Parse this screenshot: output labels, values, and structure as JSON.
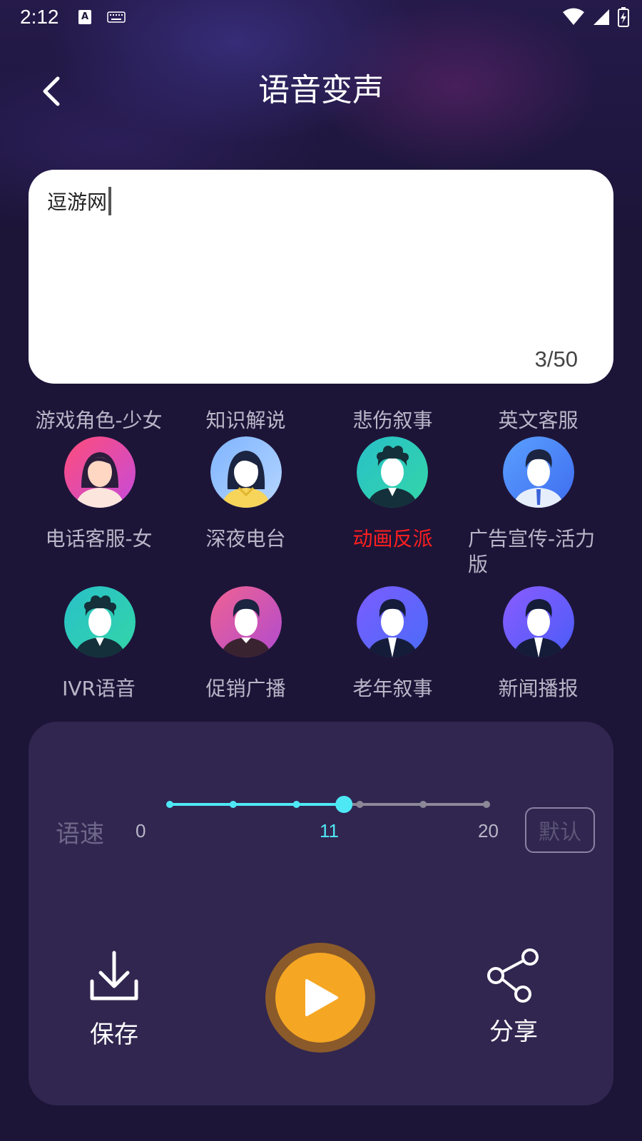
{
  "status": {
    "time": "2:12",
    "input_icon": "A"
  },
  "header": {
    "title": "语音变声"
  },
  "editor": {
    "text": "逗游网",
    "counter": "3/50"
  },
  "voices": [
    {
      "label": "游戏角色-少女",
      "icon": "female-avatar-icon"
    },
    {
      "label": "知识解说",
      "icon": "female-avatar-icon"
    },
    {
      "label": "悲伤叙事",
      "icon": "male-curly-avatar-icon"
    },
    {
      "label": "英文客服",
      "icon": "male-avatar-icon"
    },
    {
      "label": "电话客服-女",
      "icon": "male-curly-avatar-icon"
    },
    {
      "label": "深夜电台",
      "icon": "male-avatar-icon"
    },
    {
      "label": "动画反派",
      "icon": "male-avatar-icon",
      "selected": true
    },
    {
      "label": "广告宣传-活力版",
      "icon": "male-avatar-icon"
    },
    {
      "label": "IVR语音"
    },
    {
      "label": "促销广播"
    },
    {
      "label": "老年叙事"
    },
    {
      "label": "新闻播报"
    }
  ],
  "controls": {
    "speed_label": "语速",
    "speed_min": "0",
    "speed_value": "11",
    "speed_max": "20",
    "speed_fraction": 0.55,
    "default_label": "默认",
    "save_label": "保存",
    "share_label": "分享"
  },
  "colors": {
    "accent": "#4ee8f5",
    "selected_text": "#ff1f1f",
    "play": "#f5a623"
  }
}
